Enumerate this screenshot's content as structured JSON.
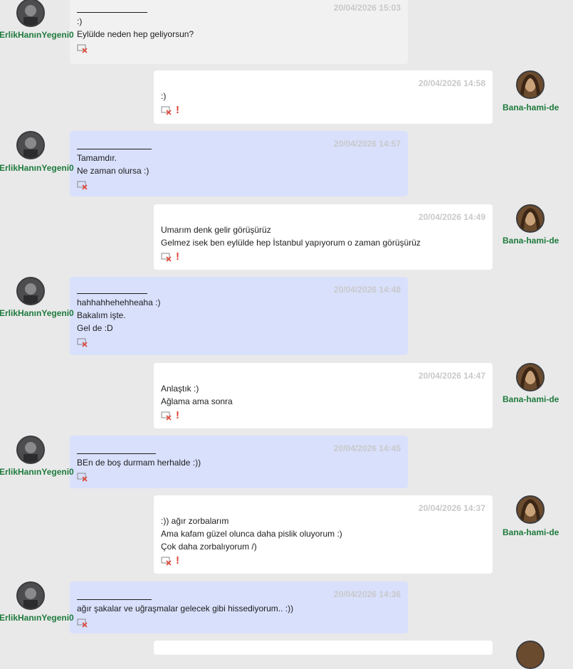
{
  "users": {
    "left": "ErlikHanınYegeni0",
    "right": "Bana-hami-de"
  },
  "icons": {
    "delete": "delete-message-icon",
    "report": "report-exclamation-icon",
    "avatar": "user-avatar"
  },
  "colors": {
    "left_bubble": "#d9e0fb",
    "right_bubble": "#ffffff",
    "username": "#1e7a3c",
    "warn": "#e04536",
    "background": "#e9e9ea"
  },
  "messages": [
    {
      "side": "left",
      "time": "20/04/2026 15:03",
      "lines": [
        ":)",
        "Eylülde neden hep geliyorsun?"
      ]
    },
    {
      "side": "right",
      "time": "20/04/2026 14:58",
      "lines": [
        ":)"
      ]
    },
    {
      "side": "left",
      "time": "20/04/2026 14:57",
      "lines": [
        "Tamamdır.",
        "Ne zaman olursa :)"
      ]
    },
    {
      "side": "right",
      "time": "20/04/2026 14:49",
      "lines": [
        "Umarım denk gelir görüşürüz",
        "Gelmez isek ben eylülde hep İstanbul yapıyorum o zaman görüşürüz"
      ]
    },
    {
      "side": "left",
      "time": "20/04/2026 14:48",
      "lines": [
        "hahhahhehehheaha :)",
        "Bakalım işte.",
        "Gel de :D"
      ]
    },
    {
      "side": "right",
      "time": "20/04/2026 14:47",
      "lines": [
        "Anlaştık :)",
        "Ağlama ama sonra"
      ]
    },
    {
      "side": "left",
      "time": "20/04/2026 14:45",
      "lines": [
        "BEn de boş durmam herhalde :))"
      ]
    },
    {
      "side": "right",
      "time": "20/04/2026 14:37",
      "lines": [
        ":)) ağır zorbalarım",
        "Ama kafam güzel olunca daha pislik oluyorum :)",
        "Çok daha zorbalıyorum /)"
      ]
    },
    {
      "side": "left",
      "time": "20/04/2026 14:36",
      "lines": [
        "ağır şakalar ve uğraşmalar gelecek gibi hissediyorum.. :))"
      ]
    }
  ]
}
